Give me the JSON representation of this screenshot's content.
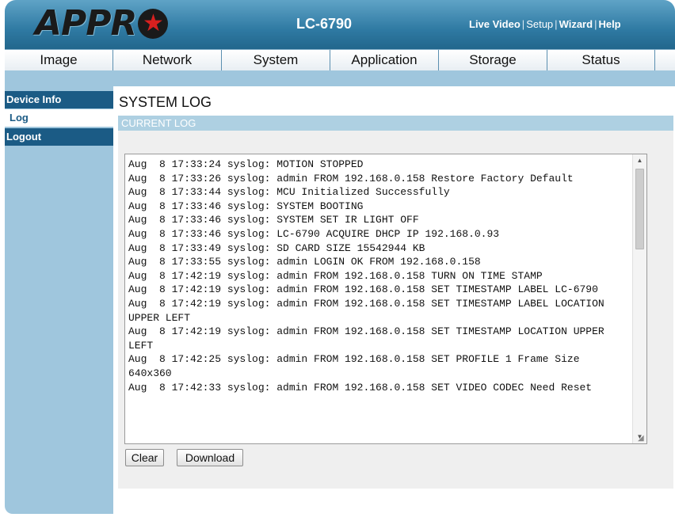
{
  "header": {
    "logo_text": "APPR",
    "logo_star": "★",
    "model": "LC-6790",
    "links": {
      "live_video": "Live Video",
      "setup": "Setup",
      "wizard": "Wizard",
      "help": "Help",
      "separator": "|"
    }
  },
  "nav": {
    "tabs": [
      {
        "label": "Image"
      },
      {
        "label": "Network"
      },
      {
        "label": "System"
      },
      {
        "label": "Application"
      },
      {
        "label": "Storage"
      },
      {
        "label": "Status"
      }
    ]
  },
  "sidebar": {
    "items": [
      {
        "label": "Device Info"
      },
      {
        "label": "Log"
      },
      {
        "label": "Logout"
      }
    ]
  },
  "main": {
    "title": "SYSTEM LOG",
    "section": "CURRENT LOG",
    "log": "Aug  8 17:33:24 syslog: MOTION STOPPED\nAug  8 17:33:26 syslog: admin FROM 192.168.0.158 Restore Factory Default\nAug  8 17:33:44 syslog: MCU Initialized Successfully\nAug  8 17:33:46 syslog: SYSTEM BOOTING\nAug  8 17:33:46 syslog: SYSTEM SET IR LIGHT OFF\nAug  8 17:33:46 syslog: LC-6790 ACQUIRE DHCP IP 192.168.0.93\nAug  8 17:33:49 syslog: SD CARD SIZE 15542944 KB\nAug  8 17:33:55 syslog: admin LOGIN OK FROM 192.168.0.158\nAug  8 17:42:19 syslog: admin FROM 192.168.0.158 TURN ON TIME STAMP\nAug  8 17:42:19 syslog: admin FROM 192.168.0.158 SET TIMESTAMP LABEL LC-6790\nAug  8 17:42:19 syslog: admin FROM 192.168.0.158 SET TIMESTAMP LABEL LOCATION UPPER LEFT\nAug  8 17:42:19 syslog: admin FROM 192.168.0.158 SET TIMESTAMP LOCATION UPPER LEFT\nAug  8 17:42:25 syslog: admin FROM 192.168.0.158 SET PROFILE 1 Frame Size 640x360\nAug  8 17:42:33 syslog: admin FROM 192.168.0.158 SET VIDEO CODEC Need Reset",
    "buttons": {
      "clear": "Clear",
      "download": "Download"
    }
  },
  "icons": {
    "scroll_up": "▲",
    "scroll_down": "▼",
    "resize_grip": "◢"
  },
  "colors": {
    "header_blue": "#2f7aa3",
    "sidebar_dark": "#1b5b85",
    "light_blue": "#9fc6dd"
  }
}
